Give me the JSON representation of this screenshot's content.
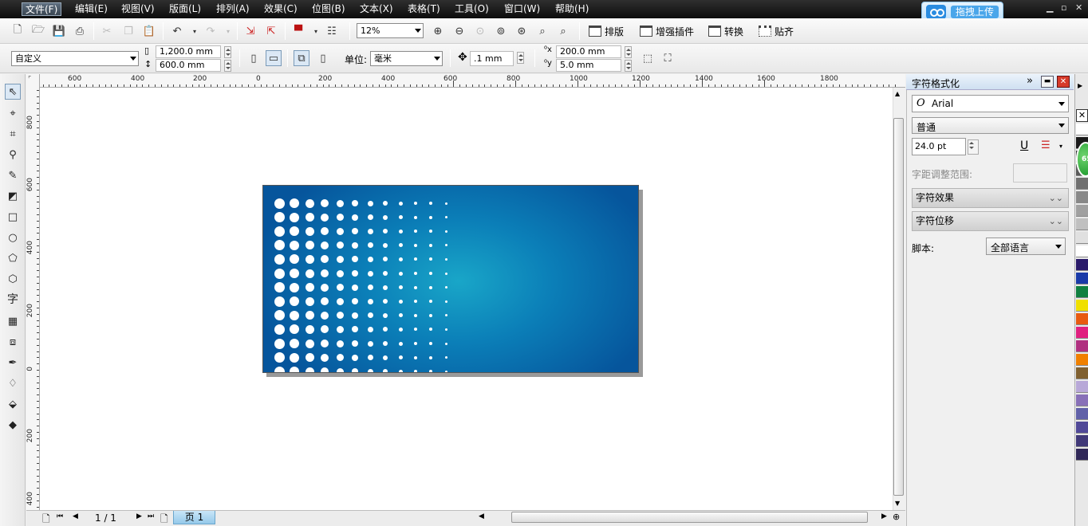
{
  "menu": [
    "文件(F)",
    "编辑(E)",
    "视图(V)",
    "版面(L)",
    "排列(A)",
    "效果(C)",
    "位图(B)",
    "文本(X)",
    "表格(T)",
    "工具(O)",
    "窗口(W)",
    "帮助(H)"
  ],
  "upload_button": "拖拽上传",
  "toolbar": {
    "zoom": "12%",
    "plugin_buttons": [
      "排版",
      "增强插件",
      "转换",
      "贴齐"
    ]
  },
  "property_bar": {
    "page_preset": "自定义",
    "page_width": "1,200.0 mm",
    "page_height": "600.0 mm",
    "unit_label": "单位:",
    "unit_value": "毫米",
    "nudge": ".1 mm",
    "dup_x": "200.0 mm",
    "dup_y": "5.0 mm"
  },
  "rulers": {
    "horizontal": [
      "600",
      "400",
      "200",
      "0",
      "200",
      "400",
      "600",
      "800",
      "1000",
      "1200",
      "1400",
      "1600",
      "1800"
    ],
    "vertical": [
      "800",
      "600",
      "400",
      "200",
      "0",
      "200",
      "400"
    ]
  },
  "status": {
    "page_count": "1 / 1",
    "page_tab": "页 1"
  },
  "docker": {
    "title": "字符格式化",
    "font_name": "Arial",
    "font_style": "普通",
    "font_size": "24.0 pt",
    "kerning_label": "字距调整范围:",
    "section_effects": "字符效果",
    "section_shift": "字符位移",
    "script_label": "脚本:",
    "script_value": "全部语言"
  },
  "badge": "65",
  "palette": [
    "#ffffff",
    "#1a1a1a",
    "#3a3a3a",
    "#5a5a5a",
    "#707070",
    "#888888",
    "#a0a0a0",
    "#c0c0c0",
    "#e0e0e0",
    "#ffffff",
    "#2a1a6a",
    "#1a3aa8",
    "#108040",
    "#f0e000",
    "#e85a10",
    "#e02080",
    "#b03080",
    "#f08000",
    "#806030",
    "#b8a8d8",
    "#8870b8",
    "#6060a8",
    "#504898",
    "#403878",
    "#302858"
  ]
}
